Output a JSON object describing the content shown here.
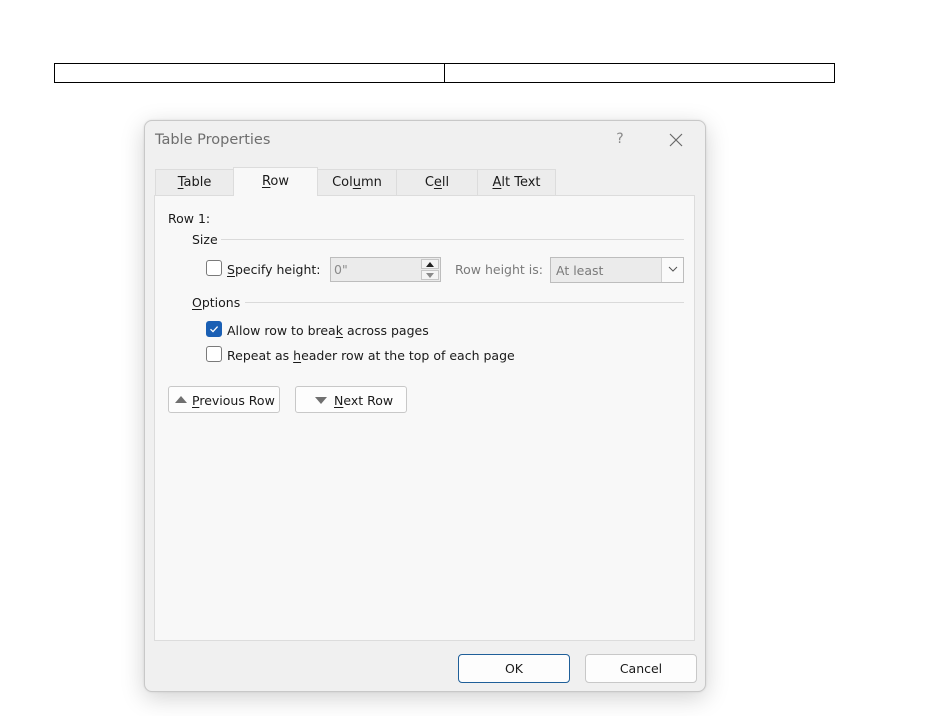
{
  "dialog": {
    "title": "Table Properties",
    "help_label": "?",
    "close_icon": "close-icon"
  },
  "tabs": [
    {
      "pre": "",
      "ul": "T",
      "post": "able",
      "active": false
    },
    {
      "pre": "",
      "ul": "R",
      "post": "ow",
      "active": true
    },
    {
      "pre": "Col",
      "ul": "u",
      "post": "mn",
      "active": false
    },
    {
      "pre": "C",
      "ul": "e",
      "post": "ll",
      "active": false
    },
    {
      "pre": "",
      "ul": "A",
      "post": "lt Text",
      "active": false
    }
  ],
  "row_panel": {
    "row_label": "Row 1:",
    "size_group": "Size",
    "specify_height": {
      "pre": "",
      "ul": "S",
      "post": "pecify height:",
      "checked": false
    },
    "height_value": "0\"",
    "row_height_is_label": "Row height is:",
    "row_height_is_value": "At least",
    "options_group": {
      "pre": "",
      "ul": "O",
      "post": "ptions"
    },
    "allow_break": {
      "pre": "Allow row to brea",
      "ul": "k",
      "post": " across pages",
      "checked": true
    },
    "repeat_header": {
      "pre": "Repeat as ",
      "ul": "h",
      "post": "eader row at the top of each page",
      "checked": false
    },
    "previous_row": {
      "pre": "",
      "ul": "P",
      "post": "revious Row"
    },
    "next_row": {
      "pre": "",
      "ul": "N",
      "post": "ext Row"
    }
  },
  "footer": {
    "ok_label": "OK",
    "cancel_label": "Cancel"
  },
  "colors": {
    "accent": "#1a5fb4",
    "ok_border": "#1f5f99"
  }
}
